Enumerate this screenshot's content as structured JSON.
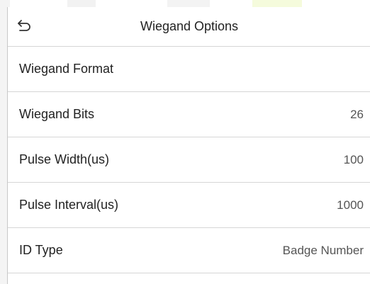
{
  "header": {
    "title": "Wiegand Options",
    "back_icon": "back-arrow-icon"
  },
  "rows": [
    {
      "label": "Wiegand Format",
      "value": ""
    },
    {
      "label": "Wiegand Bits",
      "value": "26"
    },
    {
      "label": "Pulse Width(us)",
      "value": "100"
    },
    {
      "label": "Pulse Interval(us)",
      "value": "1000"
    },
    {
      "label": "ID Type",
      "value": "Badge Number"
    }
  ]
}
